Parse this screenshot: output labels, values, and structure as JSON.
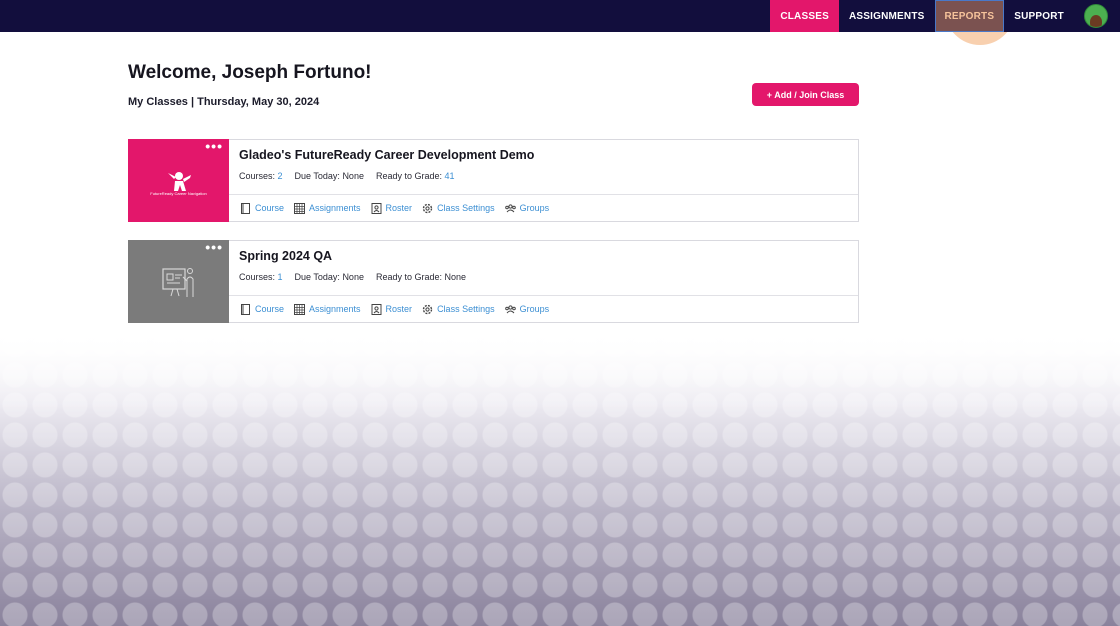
{
  "nav": {
    "items": [
      {
        "label": "CLASSES"
      },
      {
        "label": "ASSIGNMENTS"
      },
      {
        "label": "REPORTS"
      },
      {
        "label": "SUPPORT"
      }
    ],
    "avatar_icon": "user-avatar"
  },
  "header": {
    "welcome": "Welcome, Joseph Fortuno!",
    "subtitle": "My Classes | Thursday, May 30, 2024",
    "add_button": "+ Add / Join Class"
  },
  "classes": [
    {
      "title": "Gladeo's FutureReady Career Development Demo",
      "thumb_caption": "FutureReady Career Navigation",
      "courses_label": "Courses:",
      "courses_value": "2",
      "due_label": "Due Today:",
      "due_value": "None",
      "grade_label": "Ready to Grade:",
      "grade_value": "41",
      "thumb_color": "#e3176b"
    },
    {
      "title": "Spring 2024 QA",
      "courses_label": "Courses:",
      "courses_value": "1",
      "due_label": "Due Today:",
      "due_value": "None",
      "grade_label": "Ready to Grade:",
      "grade_value": "None",
      "thumb_color": "#7b7b7b"
    }
  ],
  "actions": {
    "course": "Course",
    "assignments": "Assignments",
    "roster": "Roster",
    "class_settings": "Class Settings",
    "groups": "Groups"
  },
  "colors": {
    "nav_bg": "#120e3d",
    "accent": "#e3176b",
    "link": "#3c8fd3"
  }
}
